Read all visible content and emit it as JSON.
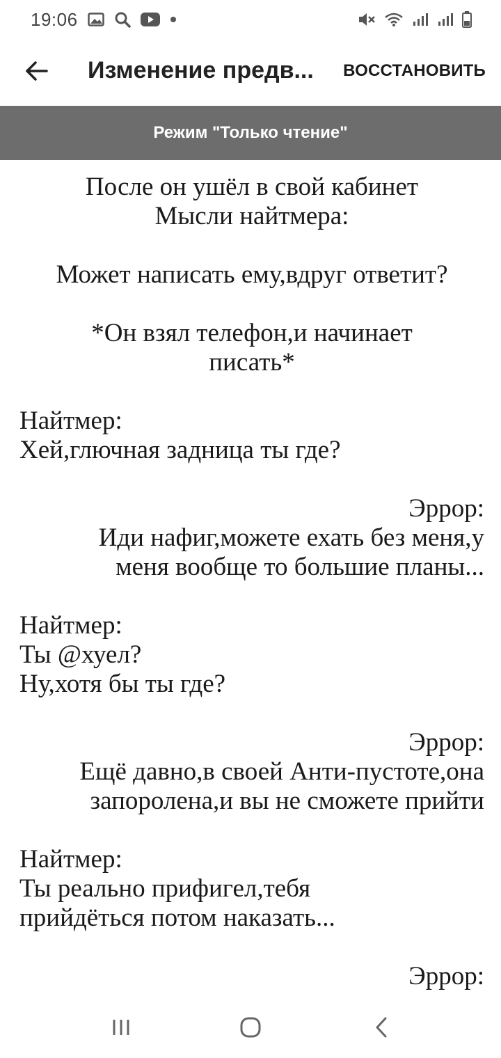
{
  "status_bar": {
    "time": "19:06",
    "icons": [
      "gallery-icon",
      "search-icon",
      "youtube-icon",
      "dot-icon",
      "mute-icon",
      "wifi-icon",
      "signal-icon",
      "signal-icon",
      "battery-icon"
    ]
  },
  "app_bar": {
    "title": "Изменение предв...",
    "restore_label": "ВОССТАНОВИТЬ"
  },
  "banner": {
    "text": "Режим \"Только чтение\""
  },
  "content": {
    "blocks": [
      {
        "align": "center",
        "text": "После он ушёл в свой кабинет\nМысли найтмера:"
      },
      {
        "align": "center",
        "text": "Может написать ему,вдруг ответит?"
      },
      {
        "align": "center",
        "text": "*Он взял телефон,и начинает\nписать*"
      },
      {
        "align": "left",
        "text": "Найтмер:\nХей,глючная задница ты где?"
      },
      {
        "align": "right",
        "text": "Эррор:\nИди нафиг,можете ехать без меня,у\nменя вообще то большие планы..."
      },
      {
        "align": "left",
        "text": "Найтмер:\nТы @хуел?\nНу,хотя бы ты где?"
      },
      {
        "align": "right",
        "text": "Эррор:\nЕщё давно,в своей Анти-пустоте,она\nзапоролена,и вы не сможете прийти"
      },
      {
        "align": "left",
        "text": "Найтмер:\nТы реально прифигел,тебя\nприйдёться потом наказать..."
      },
      {
        "align": "right",
        "text": "Эррор:"
      }
    ]
  },
  "colors": {
    "banner_bg": "#6d6d6d",
    "banner_text": "#ffffff",
    "background": "#ffffff",
    "text": "#1a1a1a"
  }
}
